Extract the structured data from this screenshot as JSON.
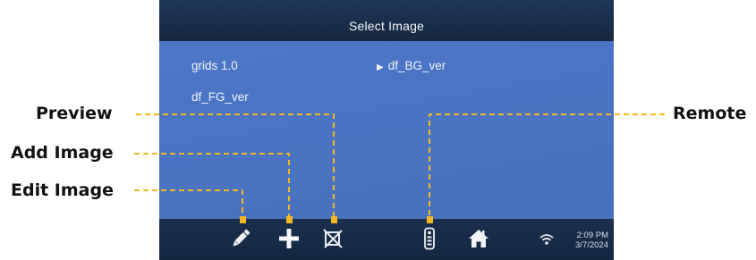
{
  "screen": {
    "title": "Select Image",
    "items": [
      {
        "label": "grids 1.0",
        "selected": false
      },
      {
        "label": "df_BG_ver",
        "selected": true
      },
      {
        "label": "df_FG_ver",
        "selected": false
      }
    ],
    "selected_marker": "▶",
    "toolbar": {
      "icons": [
        "pencil-icon",
        "plus-icon",
        "preview-crossed-icon",
        "remote-icon",
        "home-icon",
        "wifi-icon"
      ]
    },
    "clock": {
      "time": "2:09 PM",
      "date": "3/7/2024"
    }
  },
  "callouts": {
    "preview": "Preview",
    "add_image": "Add Image",
    "edit_image": "Edit Image",
    "remote": "Remote",
    "line_color": "#f3b722"
  },
  "colors": {
    "screen_bg": "#4a73c2",
    "bar_bg": "#17293f",
    "label_text": "#111111"
  }
}
